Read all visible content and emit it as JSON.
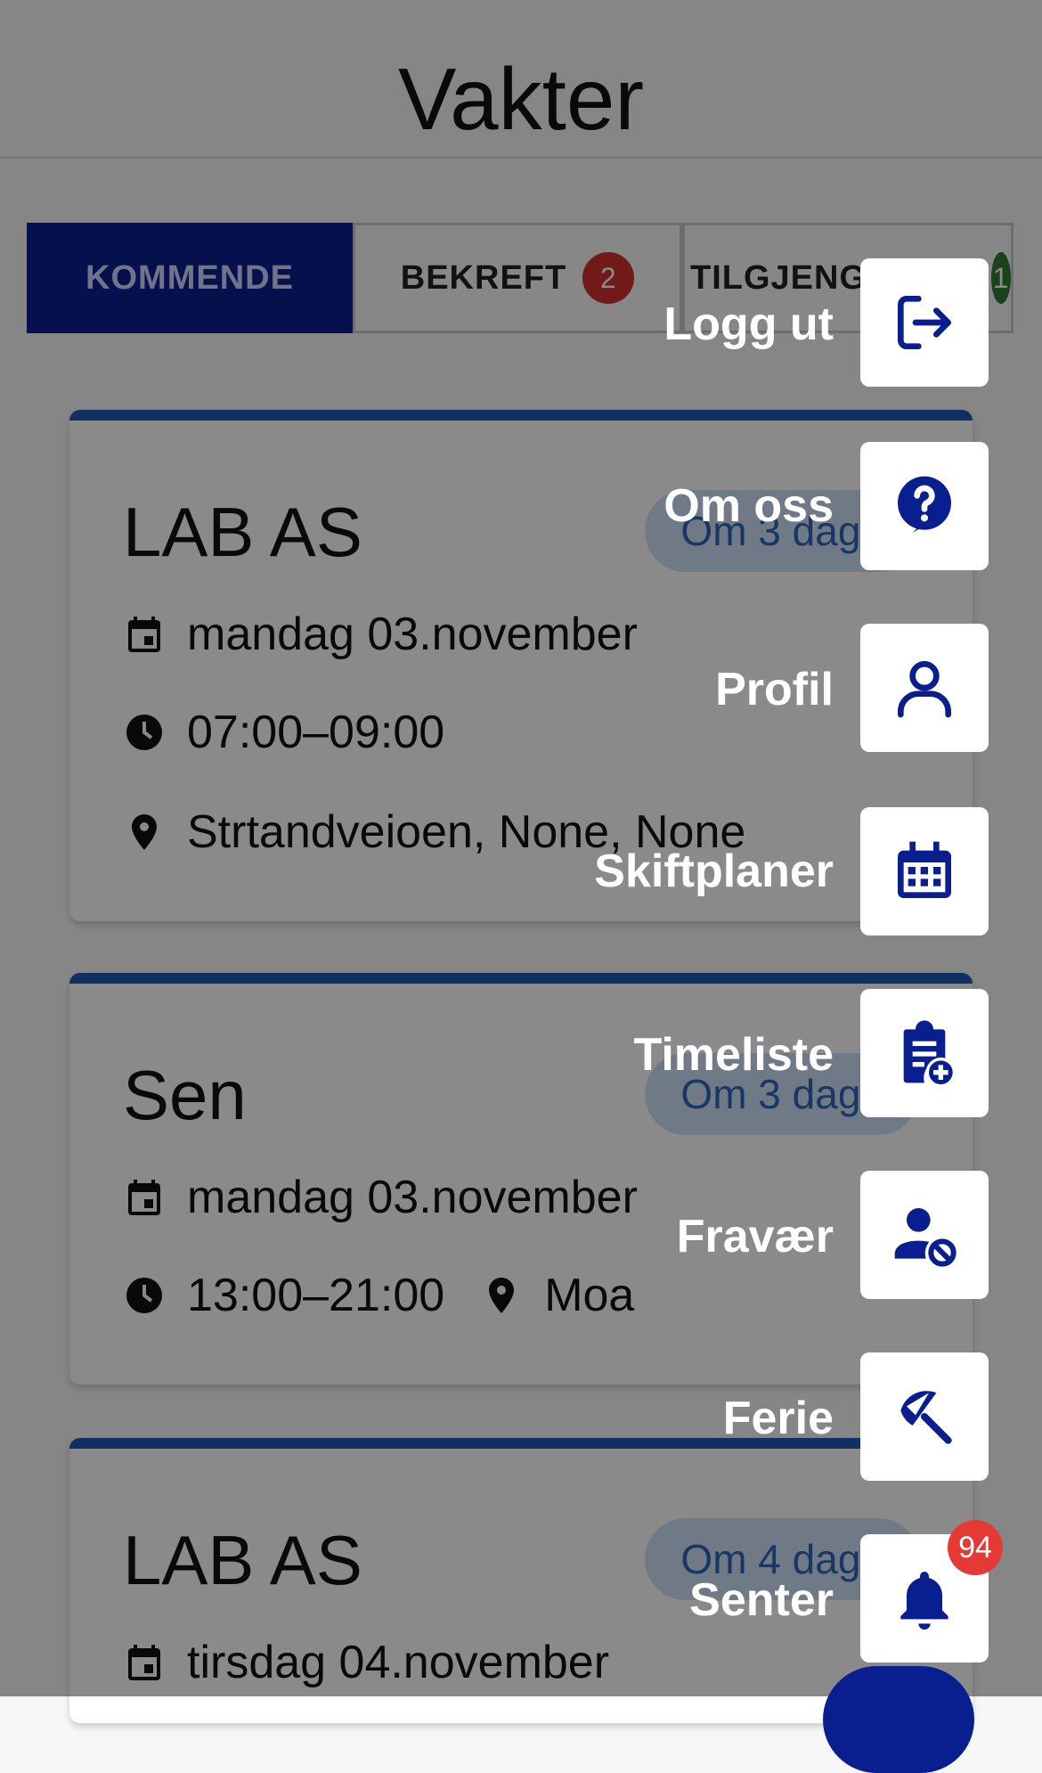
{
  "header": {
    "title": "Vakter"
  },
  "tabs": [
    {
      "label": "KOMMENDE",
      "badge": ""
    },
    {
      "label": "BEKREFT",
      "badge": "2"
    },
    {
      "label": "TILGJENG",
      "badge": "1"
    }
  ],
  "cards": [
    {
      "title": "LAB AS",
      "chip": "Om 3 dage",
      "date": "mandag 03.november",
      "time": "07:00–09:00",
      "location": "Strtandveioen, None, None"
    },
    {
      "title": "Sen",
      "chip": "Om 3 dage",
      "date": "mandag 03.november",
      "time": "13:00–21:00",
      "location": "Moa"
    },
    {
      "title": "LAB AS",
      "chip": "Om 4 dage",
      "date": "tirsdag 04.november"
    }
  ],
  "menu": [
    {
      "label": "Logg ut",
      "icon": "logout-icon"
    },
    {
      "label": "Om oss",
      "icon": "help-icon"
    },
    {
      "label": "Profil",
      "icon": "person-icon"
    },
    {
      "label": "Skiftplaner",
      "icon": "calendar-icon"
    },
    {
      "label": "Timeliste",
      "icon": "clipboard-add-icon"
    },
    {
      "label": "Fravær",
      "icon": "person-block-icon"
    },
    {
      "label": "Ferie",
      "icon": "beach-umbrella-icon"
    },
    {
      "label": "Senter",
      "icon": "bell-icon"
    }
  ],
  "notifications": {
    "count": "94"
  },
  "colors": {
    "primary": "#0a1f8f",
    "accent": "#1e5ab5",
    "chip_bg": "#cfe1f7",
    "badge_red": "#d32f2f",
    "badge_green": "#2e7d32"
  }
}
